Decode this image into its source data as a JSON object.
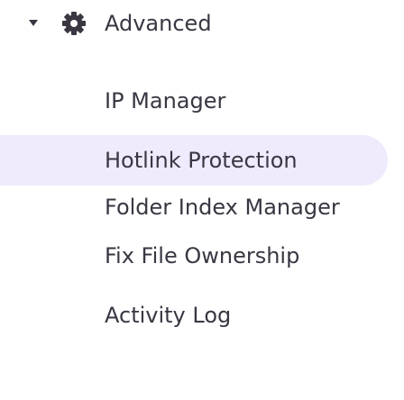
{
  "group": {
    "title": "Advanced",
    "expanded": true,
    "icon": "gear-icon",
    "caret_icon": "caret-down-icon"
  },
  "menu": {
    "items": [
      {
        "label": "IP Manager",
        "active": false
      },
      {
        "label": "Hotlink Protection",
        "active": true
      },
      {
        "label": "Folder Index Manager",
        "active": false
      },
      {
        "label": "Fix File Ownership",
        "active": false
      },
      {
        "label": "Activity Log",
        "active": false
      }
    ]
  },
  "colors": {
    "text": "#3a3642",
    "active_background": "#efeafc"
  }
}
